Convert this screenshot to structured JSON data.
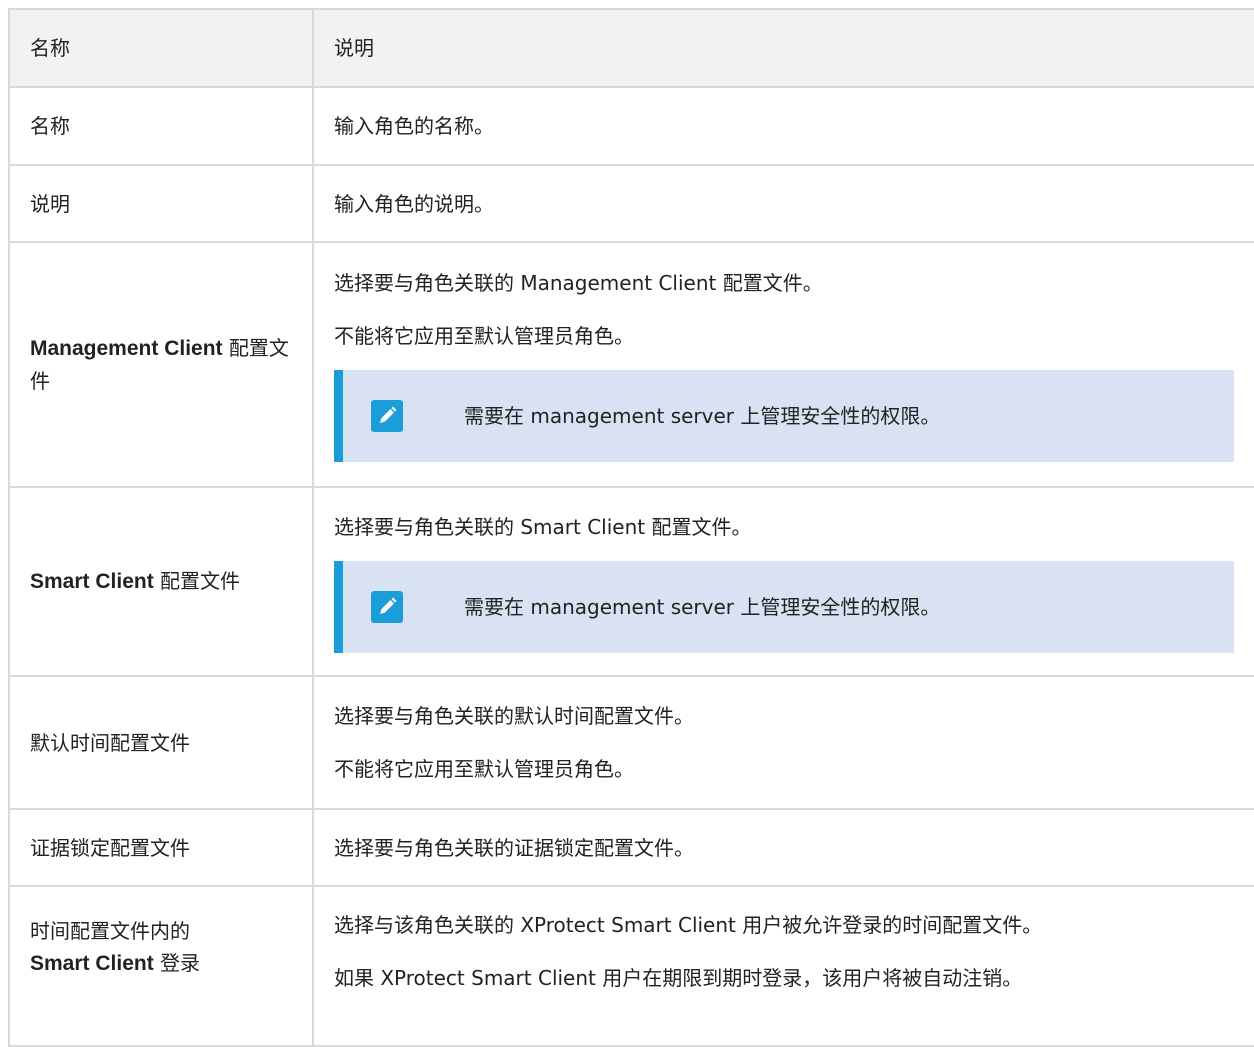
{
  "header": {
    "col_name": "名称",
    "col_desc": "说明"
  },
  "rows": [
    {
      "name": "名称",
      "desc": [
        "输入角色的名称。"
      ]
    },
    {
      "name": "说明",
      "desc": [
        "输入角色的说明。"
      ]
    },
    {
      "name_bold": "Management Client",
      "name_rest": " 配置文件",
      "desc": [
        "选择要与角色关联的 Management Client 配置文件。",
        "不能将它应用至默认管理员角色。"
      ],
      "note": "需要在 management server 上管理安全性的权限。",
      "note_icon": "pencil-icon"
    },
    {
      "name_bold": "Smart Client",
      "name_rest": " 配置文件",
      "desc": [
        "选择要与角色关联的 Smart Client 配置文件。"
      ],
      "note": "需要在 management server 上管理安全性的权限。",
      "note_icon": "pencil-icon"
    },
    {
      "name": "默认时间配置文件",
      "desc": [
        "选择要与角色关联的默认时间配置文件。",
        "不能将它应用至默认管理员角色。"
      ]
    },
    {
      "name": "证据锁定配置文件",
      "desc": [
        "选择要与角色关联的证据锁定配置文件。"
      ]
    },
    {
      "name_line1": "时间配置文件内的",
      "name_bold": "Smart Client",
      "name_rest": " 登录",
      "desc": [
        "选择与该角色关联的 XProtect Smart Client 用户被允许登录的时间配置文件。",
        "如果 XProtect Smart Client 用户在期限到期时登录，该用户将被自动注销。"
      ]
    }
  ],
  "colors": {
    "note_bg": "#d8e2f2",
    "note_accent": "#1a9dd8",
    "header_bg": "#f2f2f2",
    "border": "#d9d9d9"
  }
}
